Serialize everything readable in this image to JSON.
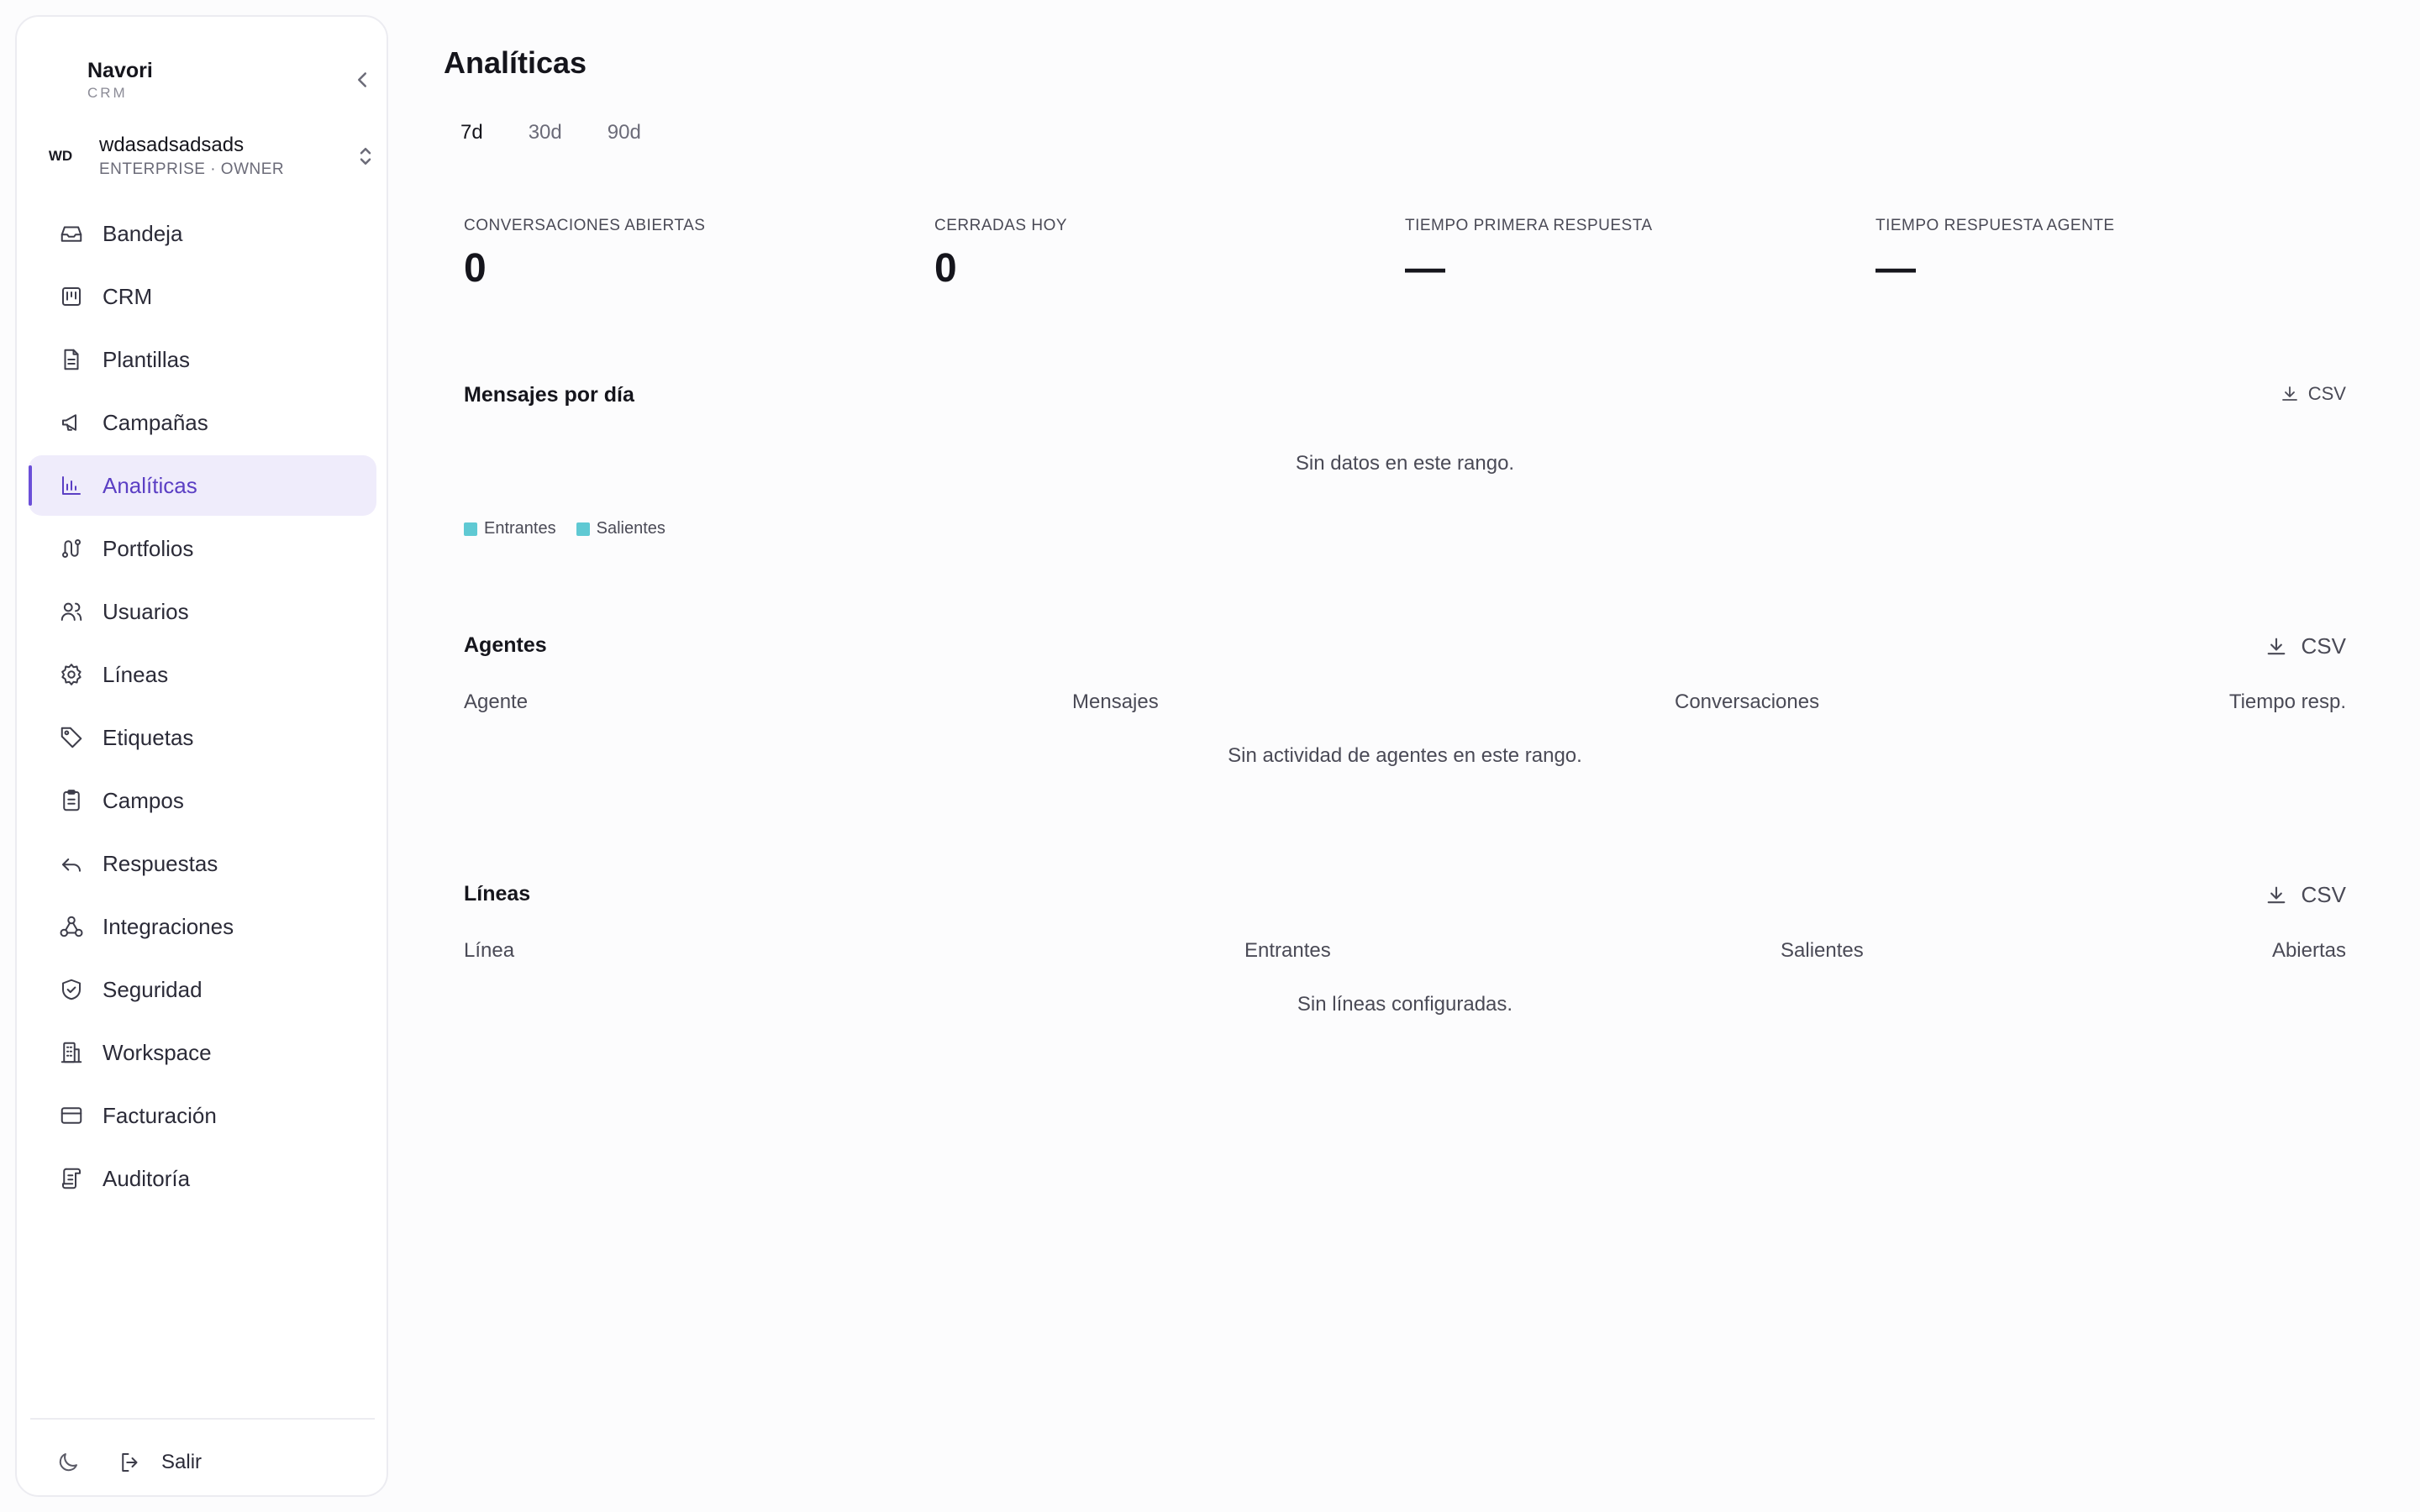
{
  "brand": {
    "name": "Navori",
    "sub": "CRM"
  },
  "workspace": {
    "badge": "WD",
    "name": "wdasadsadsads",
    "plan": "ENTERPRISE · OWNER"
  },
  "nav": [
    {
      "label": "Bandeja",
      "icon": "inbox-icon"
    },
    {
      "label": "CRM",
      "icon": "kanban-icon"
    },
    {
      "label": "Plantillas",
      "icon": "file-text-icon"
    },
    {
      "label": "Campañas",
      "icon": "megaphone-icon"
    },
    {
      "label": "Analíticas",
      "icon": "bar-chart-icon",
      "active": true
    },
    {
      "label": "Portfolios",
      "icon": "route-icon"
    },
    {
      "label": "Usuarios",
      "icon": "users-icon"
    },
    {
      "label": "Líneas",
      "icon": "gear-icon"
    },
    {
      "label": "Etiquetas",
      "icon": "tag-icon"
    },
    {
      "label": "Campos",
      "icon": "clipboard-icon"
    },
    {
      "label": "Respuestas",
      "icon": "reply-icon"
    },
    {
      "label": "Integraciones",
      "icon": "webhook-icon"
    },
    {
      "label": "Seguridad",
      "icon": "shield-check-icon"
    },
    {
      "label": "Workspace",
      "icon": "building-icon"
    },
    {
      "label": "Facturación",
      "icon": "credit-card-icon"
    },
    {
      "label": "Auditoría",
      "icon": "scroll-icon"
    }
  ],
  "footer": {
    "logout_label": "Salir"
  },
  "page": {
    "title": "Analíticas",
    "ranges": [
      "7d",
      "30d",
      "90d"
    ],
    "active_range": "7d"
  },
  "kpis": [
    {
      "label": "CONVERSACIONES ABIERTAS",
      "value": "0"
    },
    {
      "label": "CERRADAS HOY",
      "value": "0"
    },
    {
      "label": "TIEMPO PRIMERA RESPUESTA",
      "value": "—"
    },
    {
      "label": "TIEMPO RESPUESTA AGENTE",
      "value": "—"
    }
  ],
  "messages_chart": {
    "title": "Mensajes por día",
    "csv_label": "CSV",
    "empty_text": "Sin datos en este rango.",
    "legend": [
      {
        "name": "Entrantes",
        "color": "#5fc9d3"
      },
      {
        "name": "Salientes",
        "color": "#5fc9d3"
      }
    ]
  },
  "agents": {
    "title": "Agentes",
    "csv_label": "CSV",
    "columns": [
      "Agente",
      "Mensajes",
      "Conversaciones",
      "Tiempo resp."
    ],
    "empty_text": "Sin actividad de agentes en este rango."
  },
  "lines": {
    "title": "Líneas",
    "csv_label": "CSV",
    "columns": [
      "Línea",
      "Entrantes",
      "Salientes",
      "Abiertas"
    ],
    "empty_text": "Sin líneas configuradas."
  },
  "colors": {
    "accent": "#6b4fd8",
    "active_bg": "#efecfb",
    "legend": "#5fc9d3"
  }
}
